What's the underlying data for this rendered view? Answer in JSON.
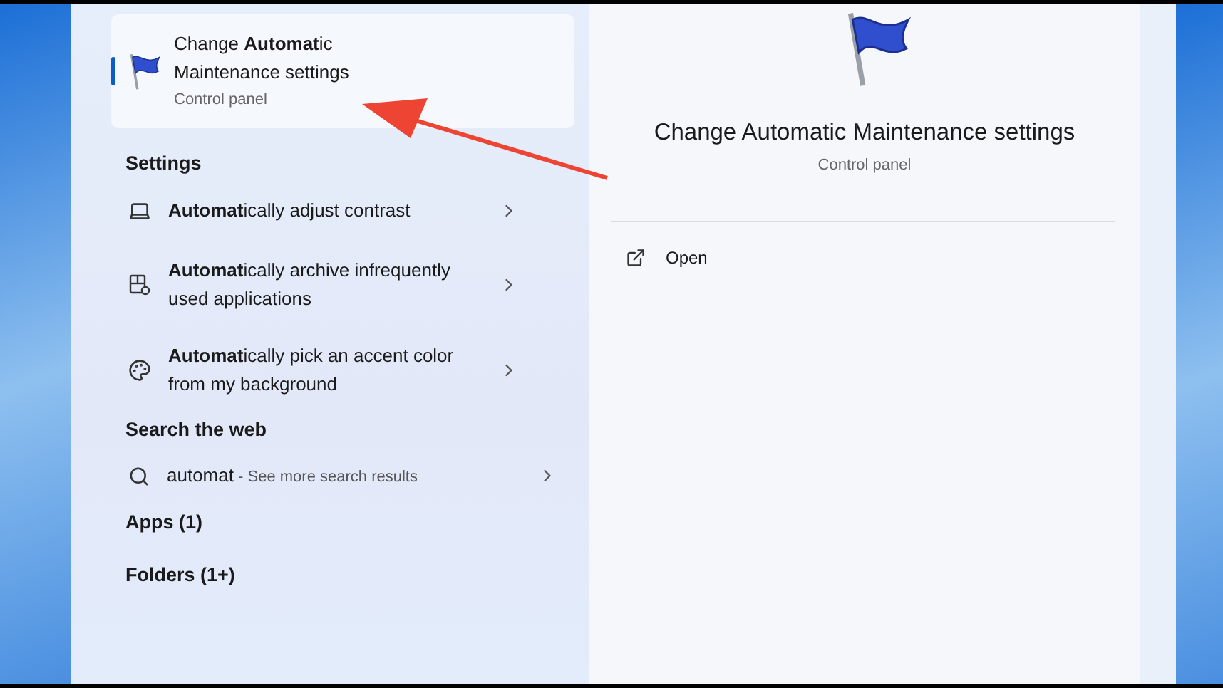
{
  "best_match": {
    "title": "Change **Automat**ic Maintenance settings",
    "subtitle": "Control panel",
    "selected": true
  },
  "settings": {
    "heading": "Settings",
    "items": [
      {
        "kind": "display",
        "title": "**Automat**ically adjust contrast"
      },
      {
        "kind": "archive",
        "title": "**Automat**ically archive infrequently used applications"
      },
      {
        "kind": "palette",
        "title": "**Automat**ically pick an accent color from my background"
      }
    ]
  },
  "web": {
    "heading": "Search the web",
    "query": "automat",
    "suffix": " - See more search results"
  },
  "categories": [
    "Apps (1)",
    "Folders (1+)"
  ],
  "detail": {
    "title": "Change Automatic Maintenance settings",
    "subtitle": "Control panel",
    "actions": [
      {
        "label": "Open"
      }
    ]
  }
}
